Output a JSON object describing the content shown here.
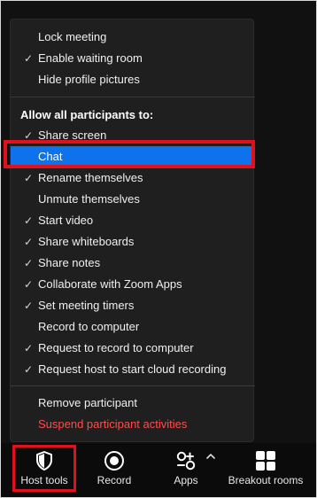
{
  "menu": {
    "top_items": [
      {
        "label": "Lock meeting",
        "checked": false
      },
      {
        "label": "Enable waiting room",
        "checked": true
      },
      {
        "label": "Hide profile pictures",
        "checked": false
      }
    ],
    "section_header": "Allow all participants to:",
    "participant_items": [
      {
        "label": "Share screen",
        "checked": true
      },
      {
        "label": "Chat",
        "checked": false,
        "highlighted": true
      },
      {
        "label": "Rename themselves",
        "checked": true
      },
      {
        "label": "Unmute themselves",
        "checked": false
      },
      {
        "label": "Start video",
        "checked": true
      },
      {
        "label": "Share whiteboards",
        "checked": true
      },
      {
        "label": "Share notes",
        "checked": true
      },
      {
        "label": "Collaborate with Zoom Apps",
        "checked": true
      },
      {
        "label": "Set meeting timers",
        "checked": true
      },
      {
        "label": "Record to computer",
        "checked": false
      },
      {
        "label": "Request to record to computer",
        "checked": true
      },
      {
        "label": "Request host to start cloud recording",
        "checked": true
      }
    ],
    "bottom_items": [
      {
        "label": "Remove participant"
      },
      {
        "label": "Suspend participant activities"
      }
    ],
    "check_glyph": "✓"
  },
  "toolbar": {
    "host_tools": {
      "label": "Host tools",
      "icon": "shield-icon"
    },
    "record": {
      "label": "Record",
      "icon": "record-icon"
    },
    "apps": {
      "label": "Apps",
      "icon": "apps-icon"
    },
    "breakout_rooms": {
      "label": "Breakout rooms",
      "icon": "grid-icon"
    }
  },
  "colors": {
    "menu_bg": "#1f1f1f",
    "highlight_bg": "#0e72ed",
    "annotation_red": "#e0101c",
    "danger_text": "#ff4c4c"
  }
}
